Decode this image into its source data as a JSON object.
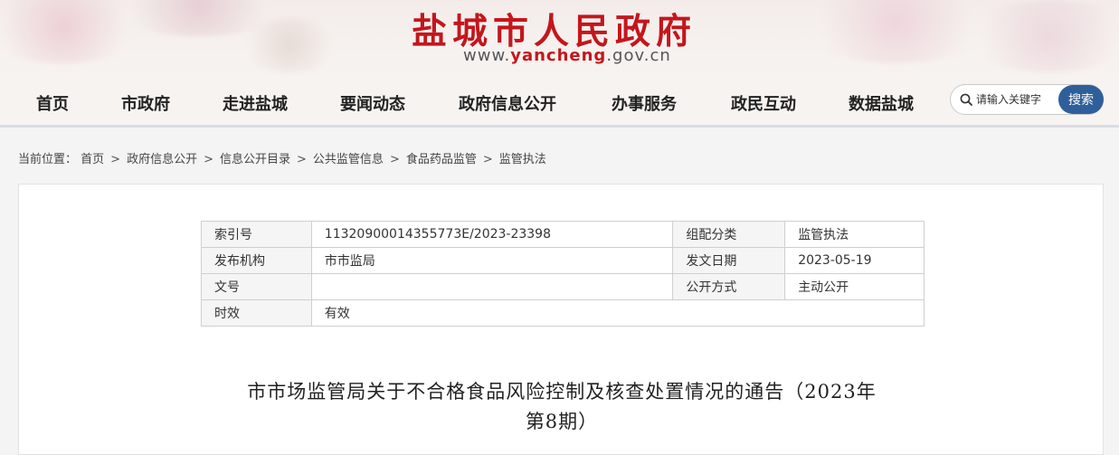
{
  "header": {
    "site_name": "盐城市人民政府",
    "url_prefix": "www.",
    "url_brand": "yancheng",
    "url_suffix": ".gov.cn"
  },
  "nav": {
    "items": [
      "首页",
      "市政府",
      "走进盐城",
      "要闻动态",
      "政府信息公开",
      "办事服务",
      "政民互动",
      "数据盐城"
    ]
  },
  "search": {
    "placeholder": "请输入关键字",
    "button_label": "搜索"
  },
  "breadcrumb": {
    "prefix": "当前位置：",
    "items": [
      "首页",
      "政府信息公开",
      "信息公开目录",
      "公共监管信息",
      "食品药品监管",
      "监管执法"
    ]
  },
  "meta_table": {
    "rows": [
      [
        "索引号",
        "11320900014355773E/2023-23398",
        "组配分类",
        "监管执法"
      ],
      [
        "发布机构",
        "市市监局",
        "发文日期",
        "2023-05-19"
      ],
      [
        "文号",
        "",
        "公开方式",
        "主动公开"
      ],
      [
        "时效",
        "有效"
      ]
    ]
  },
  "document": {
    "title_line1": "市市场监管局关于不合格食品风险控制及核查处置情况的通告（2023年",
    "title_line2": "第8期）"
  },
  "colors": {
    "brand_red": "#c4161c",
    "search_button": "#2f5f9a",
    "nav_border": "#d8dde4"
  }
}
